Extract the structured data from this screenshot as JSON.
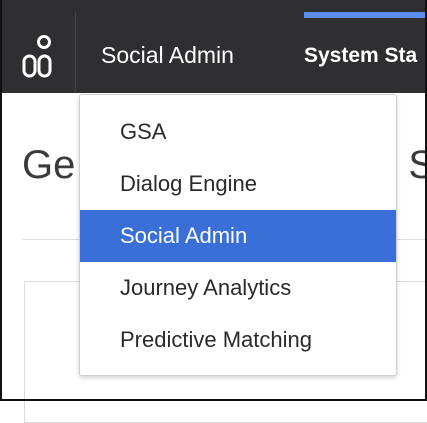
{
  "topbar": {
    "logo_icon": "genesys-logo-icon",
    "app_switcher_label": "Social Admin",
    "nav_item_label": "System Sta",
    "accent_color": "#5b8ef0",
    "background_color": "#2f2f31"
  },
  "page": {
    "heading_left": "Ge",
    "heading_right": "r S"
  },
  "dropdown": {
    "items": [
      {
        "label": "GSA",
        "selected": false
      },
      {
        "label": "Dialog Engine",
        "selected": false
      },
      {
        "label": "Social Admin",
        "selected": true
      },
      {
        "label": "Journey Analytics",
        "selected": false
      },
      {
        "label": "Predictive Matching",
        "selected": false
      }
    ],
    "selected_color": "#3a6fd8"
  }
}
